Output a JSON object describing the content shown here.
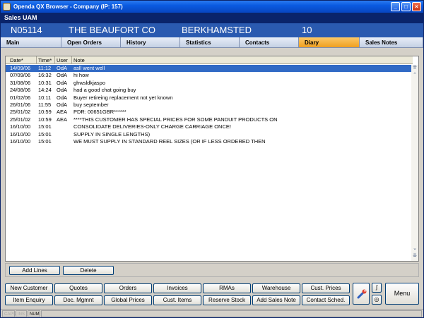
{
  "window": {
    "title": "Openda QX Browser  -  Company (IP: 157)",
    "controls": {
      "minimize": "_",
      "maximize": "□",
      "close": "×"
    }
  },
  "subtitle": "Sales UAM",
  "account": {
    "code": "N05114",
    "name": "THE BEAUFORT CO",
    "town": "BERKHAMSTED",
    "number": "10"
  },
  "tabs": [
    {
      "label": "Main"
    },
    {
      "label": "Open Orders"
    },
    {
      "label": "History"
    },
    {
      "label": "Statistics"
    },
    {
      "label": "Contacts"
    },
    {
      "label": "Diary",
      "active": true
    },
    {
      "label": "Sales Notes"
    }
  ],
  "grid": {
    "columns": [
      "Date*",
      "Time*",
      "User",
      "Note"
    ],
    "rows": [
      {
        "date": "14/09/06",
        "time": "11:12",
        "user": "OdA",
        "note": "asll went well",
        "selected": true
      },
      {
        "date": "07/09/06",
        "time": "16:32",
        "user": "OdA",
        "note": "hi how"
      },
      {
        "date": "31/08/06",
        "time": "10:31",
        "user": "OdA",
        "note": "ghwsldkjaspo"
      },
      {
        "date": "24/08/06",
        "time": "14:24",
        "user": "OdA",
        "note": "had a good chat going buy"
      },
      {
        "date": "01/02/06",
        "time": "10:11",
        "user": "OdA",
        "note": "Buyer retireing replacement not yet known"
      },
      {
        "date": "26/01/06",
        "time": "11:55",
        "user": "OdA",
        "note": "buy september"
      },
      {
        "date": "25/01/02",
        "time": "10:59",
        "user": "AEA",
        "note": "PDR: 00651GBR******"
      },
      {
        "date": "25/01/02",
        "time": "10:59",
        "user": "AEA",
        "note": "****THIS CUSTOMER HAS SPECIAL PRICES FOR SOME PANDUIT PRODUCTS ON"
      },
      {
        "date": "16/10/00",
        "time": "15:01",
        "user": "",
        "note": "CONSOLIDATE DELIVERIES-ONLY CHARGE CARRIAGE ONCE!"
      },
      {
        "date": "16/10/00",
        "time": "15:01",
        "user": "",
        "note": "SUPPLY IN SINGLE LENGTHS)"
      },
      {
        "date": "16/10/00",
        "time": "15:01",
        "user": "",
        "note": "WE MUST SUPPLY IN STANDARD REEL SIZES (OR IF LESS ORDERED THEN"
      }
    ],
    "scroll_up": "⇈",
    "scroll_step_up": "⌃",
    "scroll_step_down": "⌄",
    "scroll_down": "⇊"
  },
  "grid_buttons": {
    "add_lines": "Add Lines",
    "delete": "Delete"
  },
  "nav": {
    "row1": [
      "New Customer",
      "Quotes",
      "Orders",
      "Invoices",
      "RMAs",
      "Warehouse",
      "Cust. Prices"
    ],
    "row2": [
      "Item Enquiry",
      "Doc. Mgmnt",
      "Global Prices",
      "Cust. Items",
      "Reserve Stock",
      "Add Sales Note",
      "Contact Sched."
    ],
    "menu": "Menu",
    "small1": "ʃ",
    "small2": "◎"
  },
  "status": {
    "caps": "CAPS",
    "ins": "INS",
    "num": "NUM"
  },
  "colors": {
    "title_bar": "#0a5ae0",
    "info_bar": "#2a5ab0",
    "active_tab": "#f0a020",
    "selected_row": "#316ac5"
  }
}
